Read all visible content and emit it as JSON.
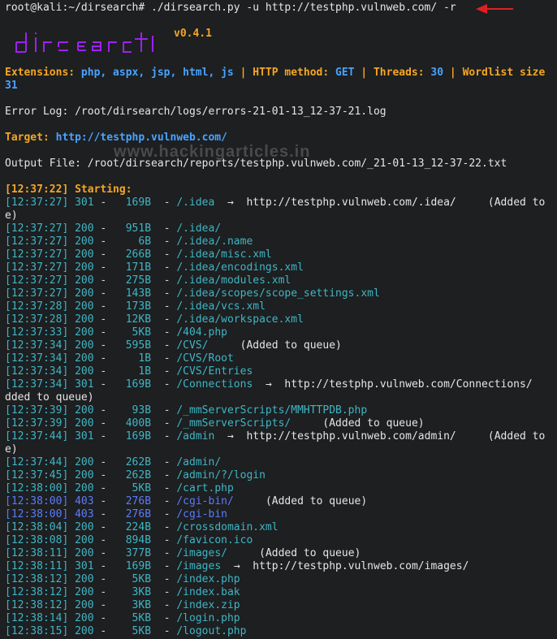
{
  "command": {
    "prompt": "root@kali:~/dirsearch#",
    "text": " ./dirsearch.py -u http://testphp.vulnweb.com/ -r"
  },
  "banner": {
    "logo_text": "dirsearch",
    "version": "v0.4.1"
  },
  "config": {
    "ext_label": "Extensions:",
    "ext_value": "php, aspx, jsp, html, js",
    "sep": "|",
    "method_label": "HTTP method:",
    "method_value": "GET",
    "threads_label": "Threads:",
    "threads_value": "30",
    "wordlist_label": "Wordlist size",
    "wordlist_value": "31"
  },
  "error_log": "Error Log: /root/dirsearch/logs/errors-21-01-13_12-37-21.log",
  "target": {
    "label": "Target:",
    "url": "http://testphp.vulnweb.com/"
  },
  "output_file": "Output File: /root/dirsearch/reports/testphp.vulnweb.com/_21-01-13_12-37-22.txt",
  "watermark": "www.hackingarticles.in",
  "starting": "[12:37:22] Starting:",
  "results": [
    {
      "time": "[12:37:27]",
      "code": "301",
      "size": "169B",
      "path": "/.idea",
      "redirect": "http://testphp.vulnweb.com/.idea/",
      "note": "(Added to",
      "cont": "e)"
    },
    {
      "time": "[12:37:27]",
      "code": "200",
      "size": "951B",
      "path": "/.idea/"
    },
    {
      "time": "[12:37:27]",
      "code": "200",
      "size": "6B",
      "path": "/.idea/.name"
    },
    {
      "time": "[12:37:27]",
      "code": "200",
      "size": "266B",
      "path": "/.idea/misc.xml"
    },
    {
      "time": "[12:37:27]",
      "code": "200",
      "size": "171B",
      "path": "/.idea/encodings.xml"
    },
    {
      "time": "[12:37:27]",
      "code": "200",
      "size": "275B",
      "path": "/.idea/modules.xml"
    },
    {
      "time": "[12:37:27]",
      "code": "200",
      "size": "143B",
      "path": "/.idea/scopes/scope_settings.xml"
    },
    {
      "time": "[12:37:28]",
      "code": "200",
      "size": "173B",
      "path": "/.idea/vcs.xml"
    },
    {
      "time": "[12:37:28]",
      "code": "200",
      "size": "12KB",
      "path": "/.idea/workspace.xml"
    },
    {
      "time": "[12:37:33]",
      "code": "200",
      "size": "5KB",
      "path": "/404.php"
    },
    {
      "time": "[12:37:34]",
      "code": "200",
      "size": "595B",
      "path": "/CVS/",
      "note": "(Added to queue)"
    },
    {
      "time": "[12:37:34]",
      "code": "200",
      "size": "1B",
      "path": "/CVS/Root"
    },
    {
      "time": "[12:37:34]",
      "code": "200",
      "size": "1B",
      "path": "/CVS/Entries"
    },
    {
      "time": "[12:37:34]",
      "code": "301",
      "size": "169B",
      "path": "/Connections",
      "redirect": "http://testphp.vulnweb.com/Connections/",
      "cont": "dded to queue)"
    },
    {
      "time": "[12:37:39]",
      "code": "200",
      "size": "93B",
      "path": "/_mmServerScripts/MMHTTPDB.php"
    },
    {
      "time": "[12:37:39]",
      "code": "200",
      "size": "400B",
      "path": "/_mmServerScripts/",
      "note": "(Added to queue)"
    },
    {
      "time": "[12:37:44]",
      "code": "301",
      "size": "169B",
      "path": "/admin",
      "redirect": "http://testphp.vulnweb.com/admin/",
      "note": "(Added to",
      "cont": "e)"
    },
    {
      "time": "[12:37:44]",
      "code": "200",
      "size": "262B",
      "path": "/admin/"
    },
    {
      "time": "[12:37:45]",
      "code": "200",
      "size": "262B",
      "path": "/admin/?/login"
    },
    {
      "time": "[12:38:00]",
      "code": "200",
      "size": "5KB",
      "path": "/cart.php"
    },
    {
      "time": "[12:38:00]",
      "code": "403",
      "size": "276B",
      "path": "/cgi-bin/",
      "note": "(Added to queue)"
    },
    {
      "time": "[12:38:00]",
      "code": "403",
      "size": "276B",
      "path": "/cgi-bin"
    },
    {
      "time": "[12:38:04]",
      "code": "200",
      "size": "224B",
      "path": "/crossdomain.xml"
    },
    {
      "time": "[12:38:08]",
      "code": "200",
      "size": "894B",
      "path": "/favicon.ico"
    },
    {
      "time": "[12:38:11]",
      "code": "200",
      "size": "377B",
      "path": "/images/",
      "note": "(Added to queue)"
    },
    {
      "time": "[12:38:11]",
      "code": "301",
      "size": "169B",
      "path": "/images",
      "redirect": "http://testphp.vulnweb.com/images/"
    },
    {
      "time": "[12:38:12]",
      "code": "200",
      "size": "5KB",
      "path": "/index.php"
    },
    {
      "time": "[12:38:12]",
      "code": "200",
      "size": "3KB",
      "path": "/index.bak"
    },
    {
      "time": "[12:38:12]",
      "code": "200",
      "size": "3KB",
      "path": "/index.zip"
    },
    {
      "time": "[12:38:14]",
      "code": "200",
      "size": "5KB",
      "path": "/login.php"
    },
    {
      "time": "[12:38:15]",
      "code": "200",
      "size": "5KB",
      "path": "/logout.php"
    }
  ],
  "colors": {
    "background": "#1d1f21",
    "accent_yellow": "#f5a623",
    "accent_blue": "#4aa3ff",
    "ok_teal": "#3fb6c4",
    "forbidden_blue": "#5c7cfa",
    "arrow_red": "#e02020"
  }
}
